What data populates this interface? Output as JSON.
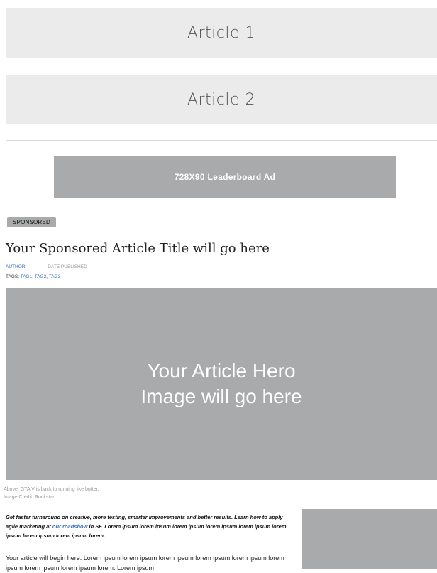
{
  "articles": [
    {
      "label": "Article 1"
    },
    {
      "label": "Article 2"
    }
  ],
  "leaderboard_ad": {
    "label": "728X90  Leaderboard Ad"
  },
  "sponsored_badge": "SPONSORED",
  "article": {
    "title": "Your Sponsored Article Title will go here",
    "author": "AUTHOR",
    "date_published": "DATE PUBLISHED",
    "tags_label": "TAGS:",
    "tags": [
      "TAG1",
      "TAG2",
      "TAG3"
    ],
    "hero_line1": "Your Article Hero",
    "hero_line2": "Image will go here",
    "caption_line1": "Above: GTA V is back to running like butter.",
    "caption_line2": "Image Credit: Rockstar",
    "lead_before_link": "Get faster turnaround on creative, more testing, smarter improvements and better results. Learn how to apply agile marketing at ",
    "lead_link": "our roadshow",
    "lead_after_link": " in SF. Lorem ipsum lorem ipsum lorem ipsum lorem ipsum lorem ipsum lorem ipsum lorem ipsum lorem ipsum lorem.",
    "body": "Your article will begin here. Lorem ipsum lorem ipsum lorem ipsum lorem ipsum lorem ipsum lorem ipsum lorem ipsum lorem ipsum lorem. Lorem ipsum"
  },
  "colors": {
    "placeholder_gray": "#a9aaab",
    "light_gray": "#ebebeb",
    "link_blue": "#3a6fb5"
  }
}
